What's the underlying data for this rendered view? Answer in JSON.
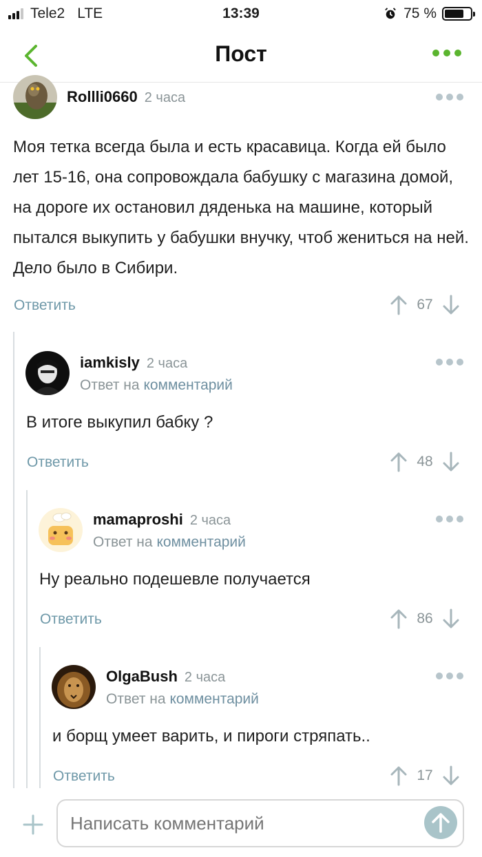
{
  "status_bar": {
    "carrier": "Tele2",
    "network": "LTE",
    "time": "13:39",
    "battery": "75 %",
    "battery_level": 0.75
  },
  "nav": {
    "title": "Пост"
  },
  "comments": [
    {
      "username": "Rollli0660",
      "time": "2 часа",
      "text": "Моя тетка всегда была и есть красавица. Когда ей было лет 15-16, она сопровождала бабушку с магазина домой, на дороге их остановил дяденька на машине, который пытался выкупить у бабушки внучку, чтоб жениться на ней. Дело было в Сибири.",
      "reply_label": "Ответить",
      "votes": "67"
    },
    {
      "username": "iamkisly",
      "time": "2 часа",
      "reply_prefix": "Ответ на",
      "reply_link": "комментарий",
      "text": "В итоге выкупил бабку ?",
      "reply_label": "Ответить",
      "votes": "48"
    },
    {
      "username": "mamaproshi",
      "time": "2 часа",
      "reply_prefix": "Ответ на",
      "reply_link": "комментарий",
      "text": "Ну реально подешевле получается",
      "reply_label": "Ответить",
      "votes": "86"
    },
    {
      "username": "OlgaBush",
      "time": "2 часа",
      "reply_prefix": "Ответ на",
      "reply_link": "комментарий",
      "text": "и борщ умеет варить, и пироги стряпать..",
      "reply_label": "Ответить",
      "votes": "17"
    }
  ],
  "composer": {
    "placeholder": "Написать комментарий"
  },
  "colors": {
    "accent_green": "#5bb52f",
    "link_blue_gray": "#6e98a8",
    "muted": "#8a9497"
  }
}
